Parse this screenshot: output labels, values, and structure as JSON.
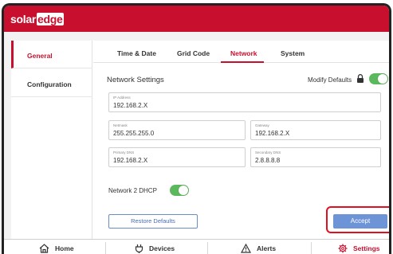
{
  "brand": {
    "part1": "solar",
    "part2": "edge"
  },
  "sidebar": {
    "items": [
      {
        "label": "General",
        "active": true
      },
      {
        "label": "Configuration",
        "active": false
      }
    ]
  },
  "tabs": [
    {
      "label": "Time & Date"
    },
    {
      "label": "Grid Code"
    },
    {
      "label": "Network",
      "active": true
    },
    {
      "label": "System"
    }
  ],
  "network": {
    "title": "Network Settings",
    "modify_defaults_label": "Modify Defaults",
    "modify_defaults_on": true,
    "ip_address": {
      "label": "IP Address",
      "value": "192.168.2.X"
    },
    "netmask": {
      "label": "Netmask",
      "value": "255.255.255.0"
    },
    "gateway": {
      "label": "Gateway",
      "value": "192.168.2.X"
    },
    "primary_dns": {
      "label": "Primary DNS",
      "value": "192.168.2.X"
    },
    "secondary_dns": {
      "label": "Secondary DNS",
      "value": "2.8.8.8.8"
    },
    "dhcp_label": "Network 2 DHCP",
    "dhcp_on": true
  },
  "buttons": {
    "restore": "Restore Defaults",
    "accept": "Accept"
  },
  "bottom_nav": [
    {
      "label": "Home",
      "icon": "home-icon"
    },
    {
      "label": "Devices",
      "icon": "plug-icon"
    },
    {
      "label": "Alerts",
      "icon": "warning-icon"
    },
    {
      "label": "Settings",
      "icon": "gear-icon",
      "active": true
    }
  ],
  "colors": {
    "brand_red": "#c8102e",
    "toggle_green": "#5cb85c",
    "accept_blue": "#6e94d8",
    "highlight_red": "#e0101f"
  }
}
